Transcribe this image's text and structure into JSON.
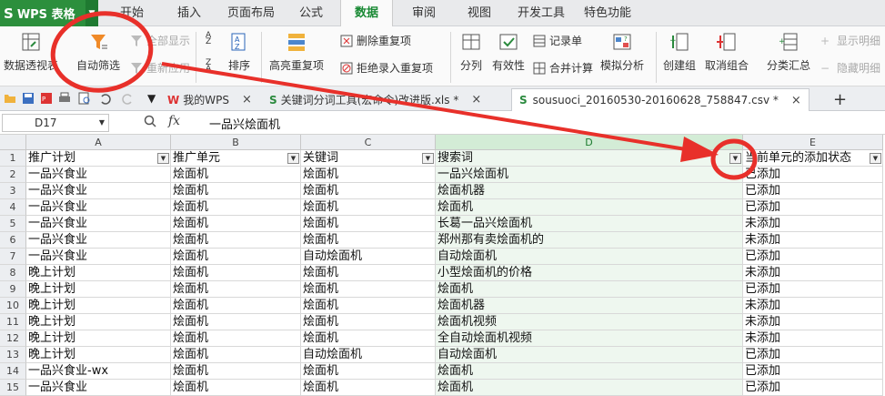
{
  "app": {
    "logo_text": "WPS 表格",
    "logo_glyph": "S"
  },
  "menu": {
    "items": [
      "开始",
      "插入",
      "页面布局",
      "公式",
      "数据",
      "审阅",
      "视图",
      "开发工具",
      "特色功能"
    ],
    "active": "数据"
  },
  "ribbon": {
    "pivot": "数据透视表",
    "autofilter": "自动筛选",
    "show_all": "全部显示",
    "reapply": "重新应用",
    "sort": "排序",
    "highlight_dup": "高亮重复项",
    "delete_dup": "删除重复项",
    "reject_dup": "拒绝录入重复项",
    "split": "分列",
    "validity": "有效性",
    "record": "记录单",
    "merge_calc": "合并计算",
    "simulate": "模拟分析",
    "create_group": "创建组",
    "ungroup": "取消组合",
    "subtotal": "分类汇总",
    "show_detail": "显示明细",
    "hide_detail": "隐藏明细"
  },
  "tabs": {
    "items": [
      "我的WPS",
      "关键词分词工具(宏命令)改进版.xls *",
      "sousuoci_20160530-20160628_758847.csv *"
    ],
    "close_glyph": "×",
    "new_tab_glyph": "+"
  },
  "formula_bar": {
    "cell_ref": "D17",
    "fx_label": "fx",
    "value": "一品兴烩面机"
  },
  "sheet": {
    "columns": [
      "A",
      "B",
      "C",
      "D",
      "E"
    ],
    "header_row": [
      "推广计划",
      "推广单元",
      "关键词",
      "搜索词",
      "当前单元的添加状态"
    ],
    "rows": [
      [
        "2",
        "一品兴食业",
        "烩面机",
        "烩面机",
        "一品兴烩面机",
        "已添加"
      ],
      [
        "3",
        "一品兴食业",
        "烩面机",
        "烩面机",
        "烩面机器",
        "已添加"
      ],
      [
        "4",
        "一品兴食业",
        "烩面机",
        "烩面机",
        "烩面机",
        "已添加"
      ],
      [
        "5",
        "一品兴食业",
        "烩面机",
        "烩面机",
        "长葛一品兴烩面机",
        "未添加"
      ],
      [
        "6",
        "一品兴食业",
        "烩面机",
        "烩面机",
        "郑州那有卖烩面机的",
        "未添加"
      ],
      [
        "7",
        "一品兴食业",
        "烩面机",
        "自动烩面机",
        "自动烩面机",
        "已添加"
      ],
      [
        "8",
        "晚上计划",
        "烩面机",
        "烩面机",
        "小型烩面机的价格",
        "未添加"
      ],
      [
        "9",
        "晚上计划",
        "烩面机",
        "烩面机",
        "烩面机",
        "已添加"
      ],
      [
        "10",
        "晚上计划",
        "烩面机",
        "烩面机",
        "烩面机器",
        "未添加"
      ],
      [
        "11",
        "晚上计划",
        "烩面机",
        "烩面机",
        "烩面机视频",
        "未添加"
      ],
      [
        "12",
        "晚上计划",
        "烩面机",
        "烩面机",
        "全自动烩面机视频",
        "未添加"
      ],
      [
        "13",
        "晚上计划",
        "烩面机",
        "自动烩面机",
        "自动烩面机",
        "已添加"
      ],
      [
        "14",
        "一品兴食业-wx",
        "烩面机",
        "烩面机",
        "烩面机",
        "已添加"
      ],
      [
        "15",
        "一品兴食业",
        "烩面机",
        "烩面机",
        "烩面机",
        "已添加"
      ]
    ]
  },
  "colors": {
    "annotation": "#e8302a",
    "accent": "#1a8a35"
  }
}
